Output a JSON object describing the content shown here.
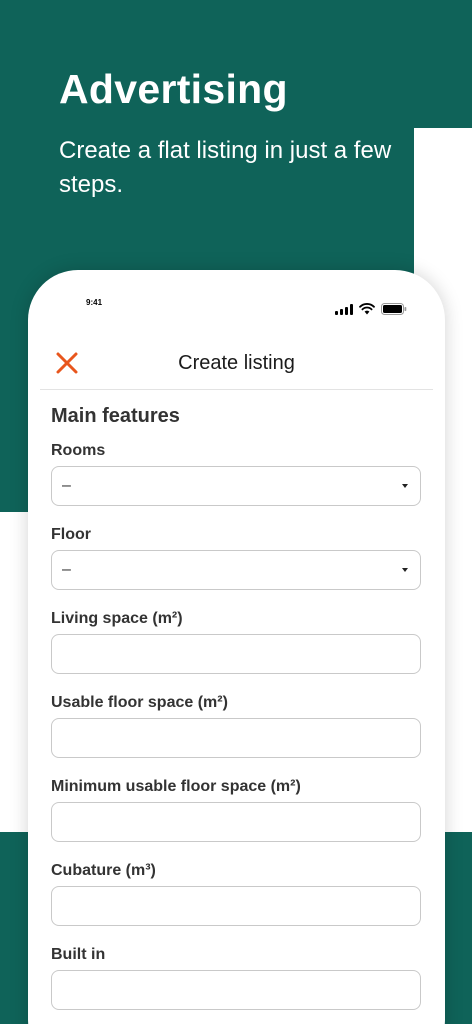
{
  "hero": {
    "title": "Advertising",
    "subtitle": "Create a flat listing in just a few steps."
  },
  "colors": {
    "brand_green": "#0f6359",
    "accent_orange": "#e8561d"
  },
  "status_bar": {
    "time": "9:41",
    "icons": [
      "signal-icon",
      "wifi-icon",
      "battery-icon"
    ]
  },
  "nav": {
    "close_icon": "close-icon",
    "title": "Create listing"
  },
  "form": {
    "section_title": "Main features",
    "fields": [
      {
        "label": "Rooms",
        "type": "select",
        "value": "–"
      },
      {
        "label": "Floor",
        "type": "select",
        "value": "–"
      },
      {
        "label": "Living space (m²)",
        "type": "input",
        "value": ""
      },
      {
        "label": "Usable floor space (m²)",
        "type": "input",
        "value": ""
      },
      {
        "label": "Minimum usable floor space (m²)",
        "type": "input",
        "value": ""
      },
      {
        "label": "Cubature (m³)",
        "type": "input",
        "value": ""
      },
      {
        "label": "Built in",
        "type": "input",
        "value": ""
      }
    ]
  }
}
